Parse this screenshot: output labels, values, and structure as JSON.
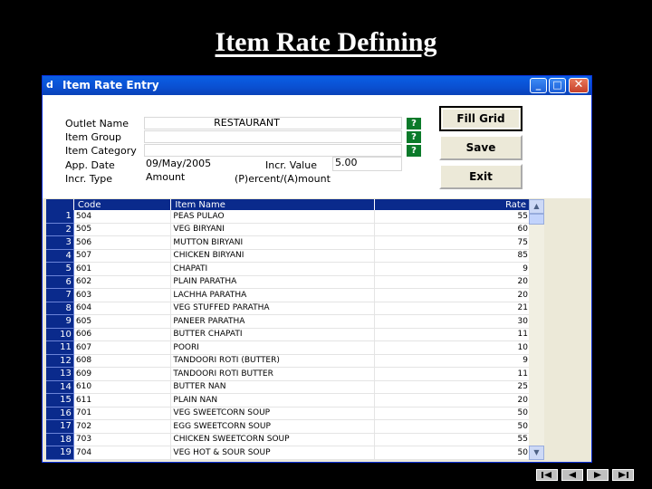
{
  "slide": {
    "title": "Item Rate Defining"
  },
  "window": {
    "title": "Item Rate Entry",
    "controls": {
      "minimize": "_",
      "maximize": "□",
      "close": "✕"
    }
  },
  "form": {
    "outlet_name_label": "Outlet Name",
    "outlet_name_value": "RESTAURANT",
    "item_group_label": "Item Group",
    "item_group_value": "",
    "item_category_label": "Item Category",
    "item_category_value": "",
    "app_date_label": "App. Date",
    "app_date_value": "09/May/2005",
    "incr_value_label": "Incr. Value",
    "incr_value_value": "5.00",
    "incr_type_label": "Incr. Type",
    "incr_type_value": "Amount",
    "incr_type_hint": "(P)ercent/(A)mount",
    "lookup_glyph": "?"
  },
  "buttons": {
    "fill_grid": "Fill Grid",
    "save": "Save",
    "exit": "Exit"
  },
  "grid": {
    "columns": [
      "Code",
      "Item Name",
      "Rate"
    ],
    "rows": [
      [
        "1",
        "504",
        "PEAS PULAO",
        "55"
      ],
      [
        "2",
        "505",
        "VEG BIRYANI",
        "60"
      ],
      [
        "3",
        "506",
        "MUTTON BIRYANI",
        "75"
      ],
      [
        "4",
        "507",
        "CHICKEN BIRYANI",
        "85"
      ],
      [
        "5",
        "601",
        "CHAPATI",
        "9"
      ],
      [
        "6",
        "602",
        "PLAIN PARATHA",
        "20"
      ],
      [
        "7",
        "603",
        "LACHHA PARATHA",
        "20"
      ],
      [
        "8",
        "604",
        "VEG STUFFED PARATHA",
        "21"
      ],
      [
        "9",
        "605",
        "PANEER PARATHA",
        "30"
      ],
      [
        "10",
        "606",
        "BUTTER CHAPATI",
        "11"
      ],
      [
        "11",
        "607",
        "POORI",
        "10"
      ],
      [
        "12",
        "608",
        "TANDOORI ROTI (BUTTER)",
        "9"
      ],
      [
        "13",
        "609",
        "TANDOORI ROTI BUTTER",
        "11"
      ],
      [
        "14",
        "610",
        "BUTTER NAN",
        "25"
      ],
      [
        "15",
        "611",
        "PLAIN NAN",
        "20"
      ],
      [
        "16",
        "701",
        "VEG SWEETCORN SOUP",
        "50"
      ],
      [
        "17",
        "702",
        "EGG SWEETCORN SOUP",
        "50"
      ],
      [
        "18",
        "703",
        "CHICKEN SWEETCORN SOUP",
        "55"
      ],
      [
        "19",
        "704",
        "VEG HOT & SOUR SOUP",
        "50"
      ]
    ]
  },
  "colors": {
    "accent": "#0a2a8c",
    "titlebar": "#0a4fd0",
    "lookup": "#0b7a2a"
  },
  "icons": {
    "nav": [
      "first-icon",
      "prev-icon",
      "next-icon",
      "last-icon"
    ]
  }
}
